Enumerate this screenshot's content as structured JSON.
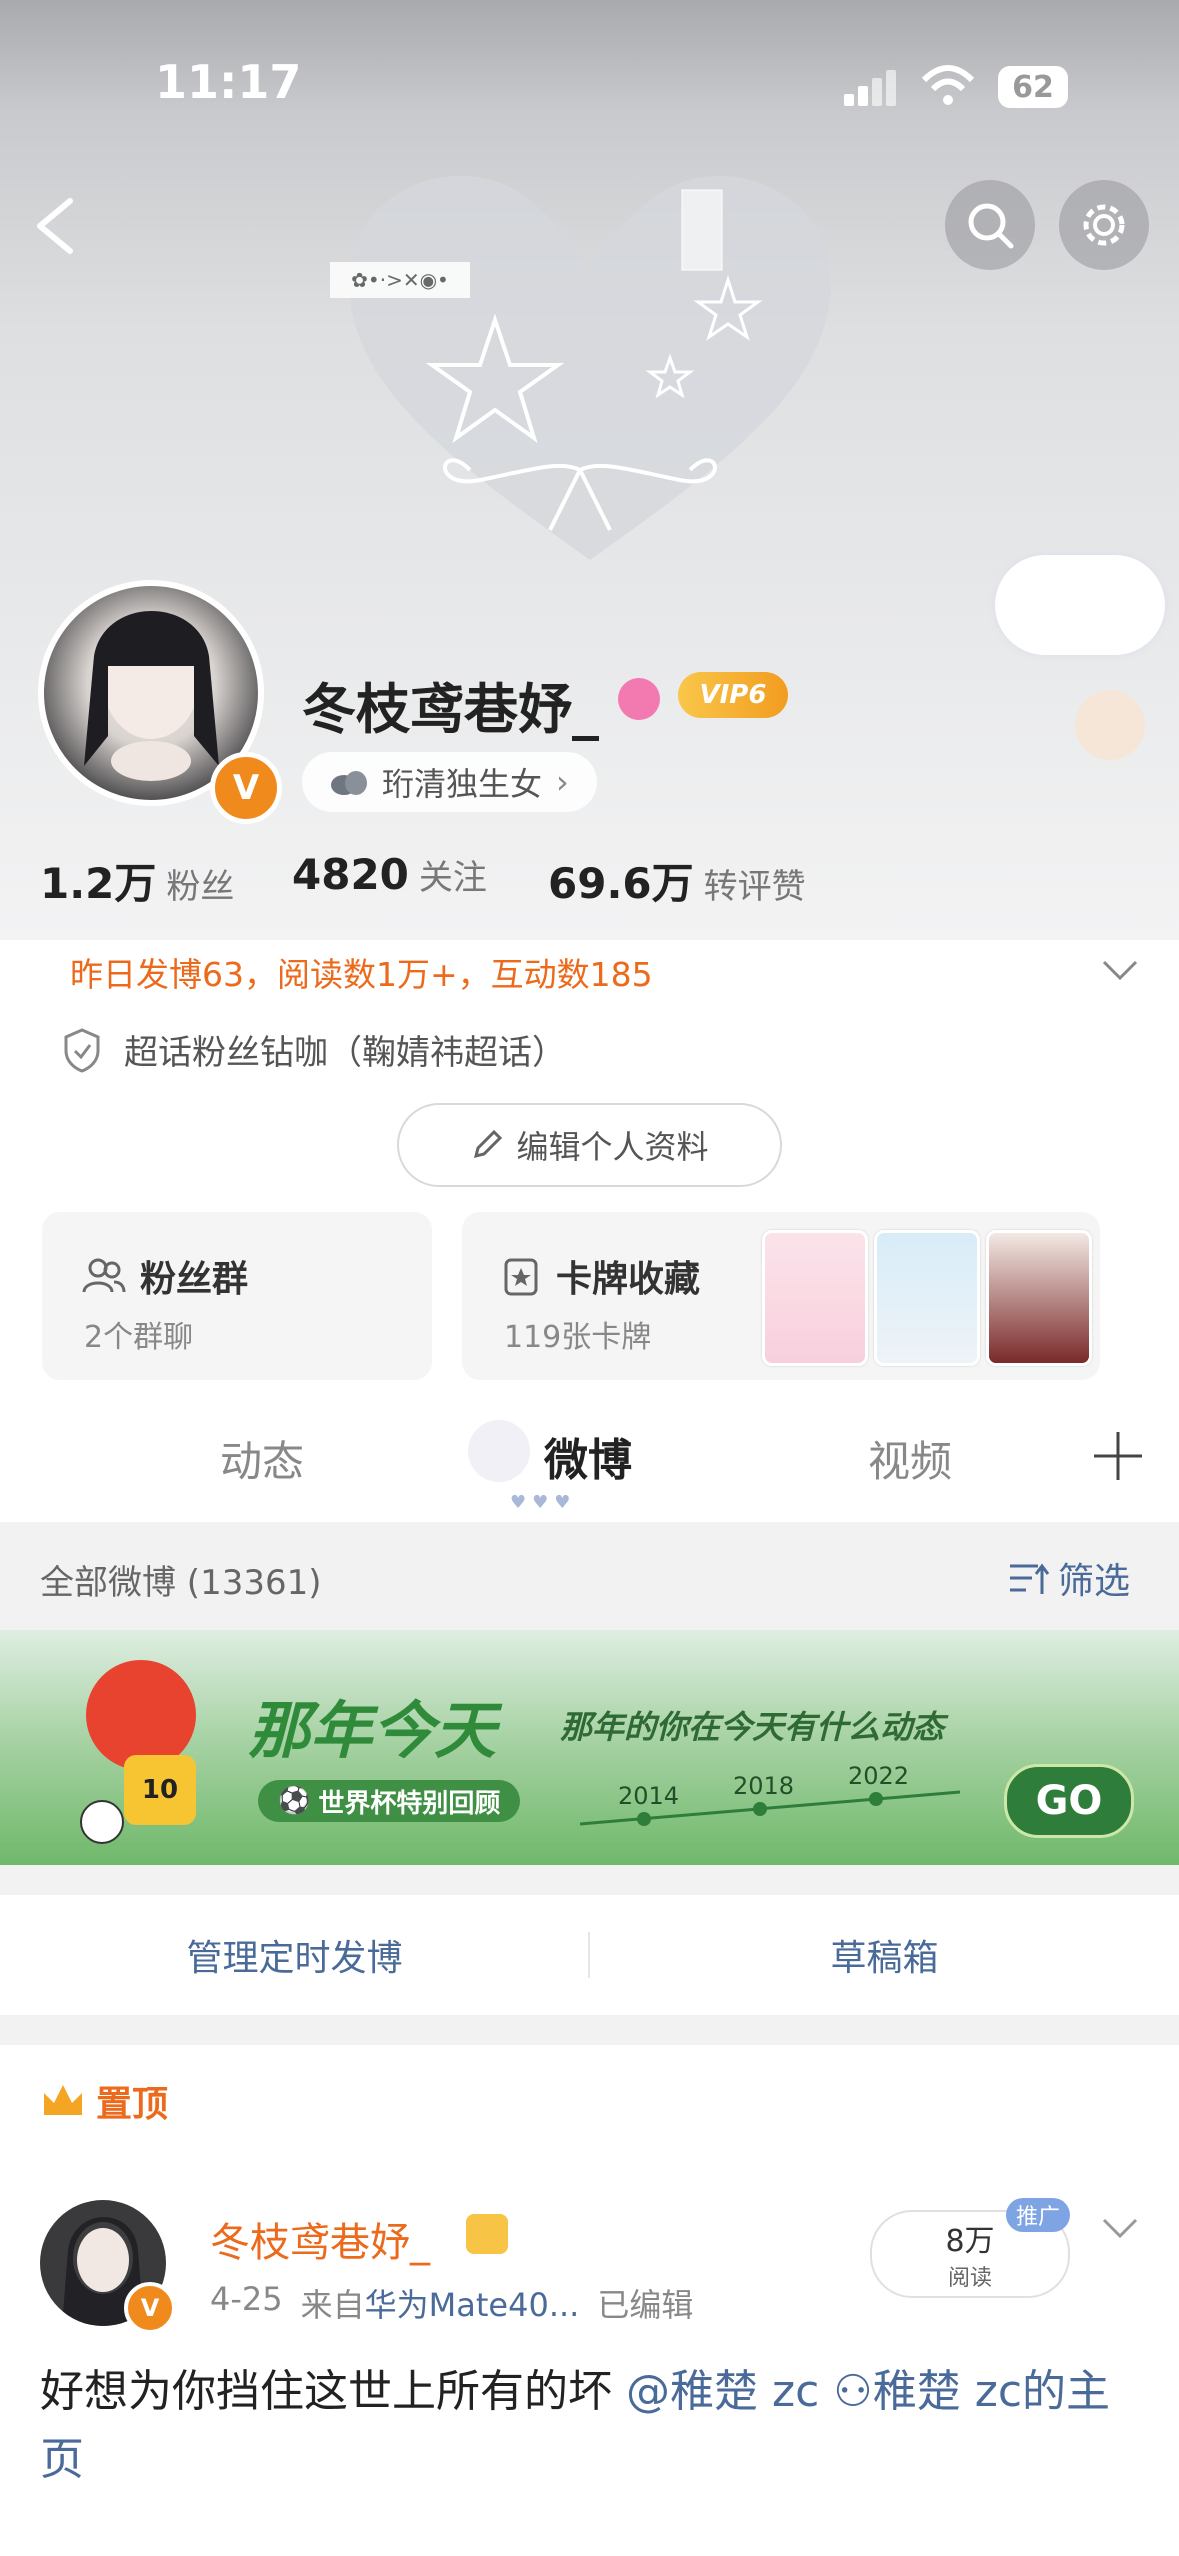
{
  "status_bar": {
    "time": "11:17",
    "battery": "62"
  },
  "profile": {
    "name": "冬枝鸢巷妤_",
    "vip": "VIP6",
    "tag": "珩清独生女",
    "stats": [
      {
        "value": "1.2万",
        "label": "粉丝"
      },
      {
        "value": "4820",
        "label": "关注"
      },
      {
        "value": "69.6万",
        "label": "转评赞"
      }
    ],
    "activity": "昨日发博63，阅读数1万+，互动数185",
    "supertopic": "超话粉丝钻咖（鞠婧祎超话）",
    "edit_button": "编辑个人资料"
  },
  "cards": {
    "fans_group": {
      "title": "粉丝群",
      "sub": "2个群聊"
    },
    "card_collection": {
      "title": "卡牌收藏",
      "sub": "119张卡牌"
    }
  },
  "tabs": [
    "动态",
    "微博",
    "视频"
  ],
  "all_weibo": {
    "label": "全部微博 (13361)",
    "filter": "筛选"
  },
  "banner_ad": {
    "title": "那年今天",
    "subtitle": "那年的你在今天有什么动态",
    "tag": "世界杯特别回顾",
    "years": [
      "2014",
      "2018",
      "2022"
    ],
    "go": "GO",
    "jersey_number": "10"
  },
  "manage": {
    "scheduled": "管理定时发博",
    "drafts": "草稿箱"
  },
  "pinned": {
    "label": "置顶",
    "author": "冬枝鸢巷妤_",
    "date": "4-25",
    "source_prefix": "来自",
    "source": "华为Mate40...",
    "edited": "已编辑",
    "reads_value": "8万",
    "reads_label": "阅读",
    "promo": "推广",
    "text": "好想为你挡住这世上所有的坏",
    "mention": "@稚楚 zc",
    "link": "稚楚 zc的主页"
  },
  "colors": {
    "accent_orange": "#ec6a1c",
    "link_blue": "#4a6b9a",
    "go_green": "#2e7d3a"
  }
}
